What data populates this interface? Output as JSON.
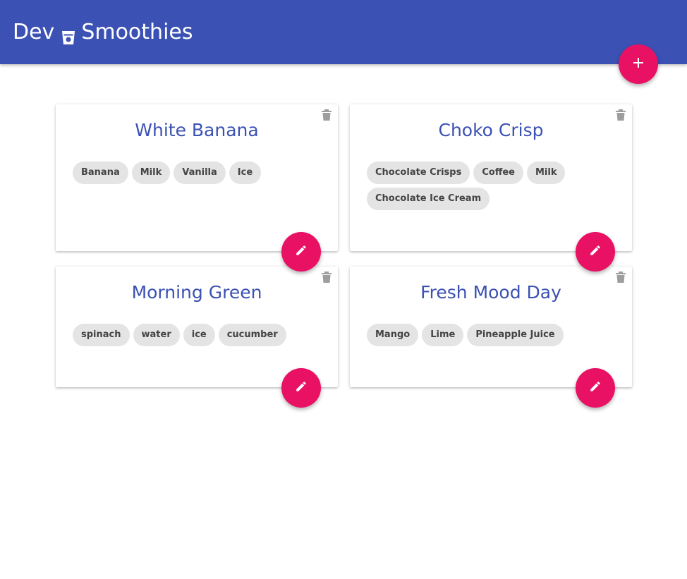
{
  "app": {
    "brand_left": "Dev",
    "brand_right": "Smoothies",
    "icons": {
      "brand": "cup-icon",
      "add": "plus-icon",
      "edit": "pencil-icon",
      "delete": "trash-icon"
    },
    "colors": {
      "primary": "#3b51b3",
      "accent": "#e91163",
      "chip_bg": "#e4e4e4",
      "icon_grey": "#9e9e9e"
    }
  },
  "cards": [
    {
      "title": "White Banana",
      "ingredients": [
        "Banana",
        "Milk",
        "Vanilla",
        "Ice"
      ]
    },
    {
      "title": "Choko Crisp",
      "ingredients": [
        "Chocolate Crisps",
        "Coffee",
        "Milk",
        "Chocolate Ice Cream"
      ]
    },
    {
      "title": "Morning Green",
      "ingredients": [
        "spinach",
        "water",
        "ice",
        "cucumber"
      ]
    },
    {
      "title": "Fresh Mood Day",
      "ingredients": [
        "Mango",
        "Lime",
        "Pineapple Juice"
      ]
    }
  ]
}
